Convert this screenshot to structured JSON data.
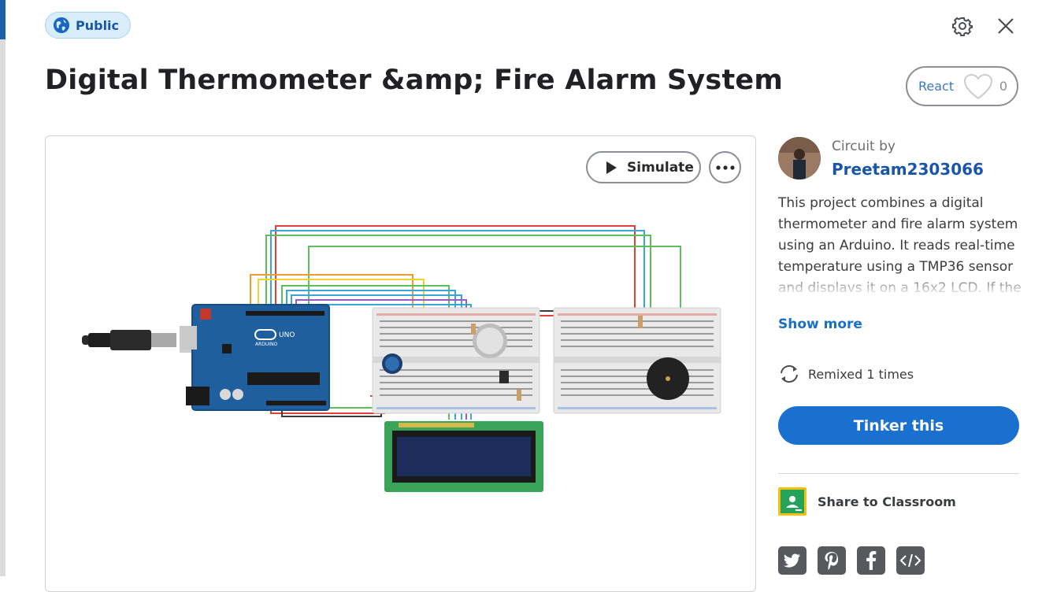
{
  "badge": {
    "label": "Public",
    "icon": "globe-icon"
  },
  "header": {
    "title": "Digital Thermometer &amp; Fire Alarm System",
    "settings_icon": "gear-icon",
    "close_icon": "close-icon"
  },
  "react": {
    "label": "React",
    "count": "0",
    "icon": "heart-icon"
  },
  "toolbar": {
    "simulate_label": "Simulate",
    "more_icon": "more-icon"
  },
  "author": {
    "by_label": "Circuit by",
    "name": "Preetam2303066"
  },
  "description": "This project combines a digital thermometer and fire alarm system using an Arduino. It reads real-time temperature using a TMP36 sensor and displays it on a 16x2 LCD. If the",
  "show_more": "Show more",
  "remix": {
    "label": "Remixed 1 times",
    "icon": "remix-icon"
  },
  "tinker": {
    "label": "Tinker this"
  },
  "classroom": {
    "label": "Share to Classroom",
    "icon": "google-classroom-icon"
  },
  "share": [
    "twitter-icon",
    "pinterest-icon",
    "facebook-icon",
    "embed-code-icon"
  ],
  "colors": {
    "accent": "#1a70cf",
    "link": "#1a56a8",
    "badge_bg": "#d9eefc",
    "share_bg": "#56595d"
  }
}
